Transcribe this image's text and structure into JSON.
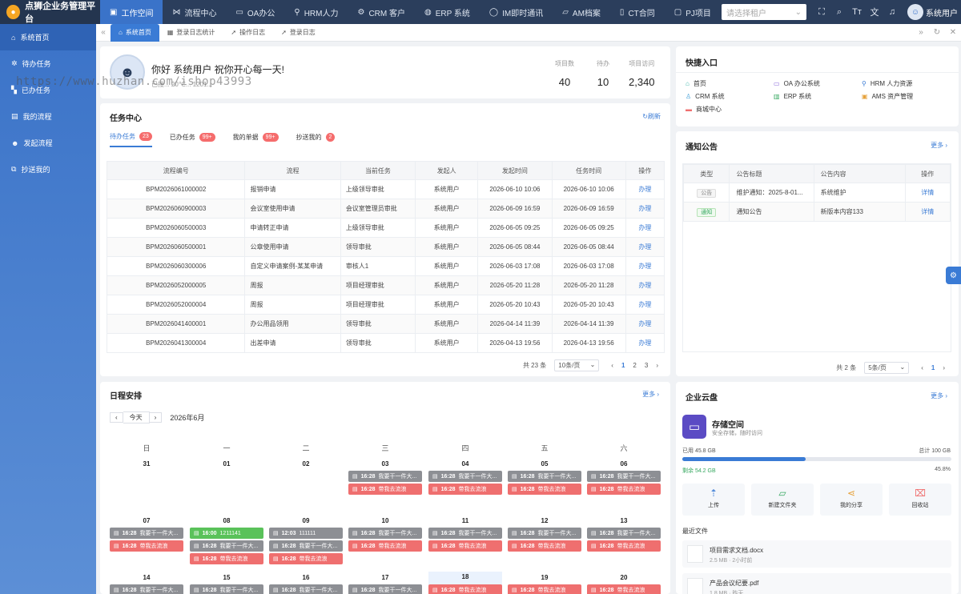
{
  "topbar": {
    "title": "点狮企业务管理平台",
    "nav": [
      {
        "label": "工作空间",
        "icon": "briefcase-icon",
        "active": true
      },
      {
        "label": "流程中心",
        "icon": "flow-icon"
      },
      {
        "label": "OA办公",
        "icon": "monitor-icon"
      },
      {
        "label": "HRM人力",
        "icon": "person-icon"
      },
      {
        "label": "CRM 客户",
        "icon": "gear-icon"
      },
      {
        "label": "ERP 系统",
        "icon": "globe-icon"
      },
      {
        "label": "IM即时通讯",
        "icon": "chat-icon"
      },
      {
        "label": "AM档案",
        "icon": "folder-icon"
      },
      {
        "label": "CT合同",
        "icon": "bookmark-icon"
      },
      {
        "label": "PJ项目",
        "icon": "project-icon"
      }
    ],
    "more": "···",
    "tenant_placeholder": "请选择租户",
    "user_name": "系统用户"
  },
  "sidebar": {
    "items": [
      {
        "label": "系统首页",
        "active": true
      },
      {
        "label": "待办任务"
      },
      {
        "label": "已办任务"
      },
      {
        "label": "我的流程"
      },
      {
        "label": "发起流程"
      },
      {
        "label": "抄送我的"
      }
    ]
  },
  "tabs": [
    {
      "label": "系统首页",
      "active": true
    },
    {
      "label": "登录日志统计"
    },
    {
      "label": "操作日志"
    },
    {
      "label": "登录日志"
    }
  ],
  "welcome": {
    "greeting": "你好 系统用户 祝你开心每一天!",
    "sub": "已接...  20℃...  1201...",
    "stats": [
      {
        "label": "项目数",
        "value": "40"
      },
      {
        "label": "待办",
        "value": "10"
      },
      {
        "label": "项目访问",
        "value": "2,340"
      }
    ]
  },
  "tasks": {
    "title": "任务中心",
    "refresh": "刷新",
    "tabs": [
      {
        "label": "待办任务",
        "badge": "23",
        "active": true
      },
      {
        "label": "已办任务",
        "badge": "99+"
      },
      {
        "label": "我的单据",
        "badge": "99+"
      },
      {
        "label": "抄送我的",
        "badge": "2"
      }
    ],
    "columns": [
      "流程编号",
      "流程",
      "当前任务",
      "发起人",
      "发起时间",
      "任务时间",
      "操作"
    ],
    "rows": [
      [
        "BPM2026061000002",
        "报销申请",
        "上级领导审批",
        "系统用户",
        "2026-06-10 10:06",
        "2026-06-10 10:06",
        "办理"
      ],
      [
        "BPM2026060900003",
        "会议室使用申请",
        "会议室管理员审批",
        "系统用户",
        "2026-06-09 16:59",
        "2026-06-09 16:59",
        "办理"
      ],
      [
        "BPM2026060500003",
        "申请转正申请",
        "上级领导审批",
        "系统用户",
        "2026-06-05 09:25",
        "2026-06-05 09:25",
        "办理"
      ],
      [
        "BPM2026060500001",
        "公章使用申请",
        "领导审批",
        "系统用户",
        "2026-06-05 08:44",
        "2026-06-05 08:44",
        "办理"
      ],
      [
        "BPM2026060300006",
        "自定义申请案例-某某申请",
        "审核人1",
        "系统用户",
        "2026-06-03 17:08",
        "2026-06-03 17:08",
        "办理"
      ],
      [
        "BPM2026052000005",
        "周报",
        "项目经理审批",
        "系统用户",
        "2026-05-20 11:28",
        "2026-05-20 11:28",
        "办理"
      ],
      [
        "BPM2026052000004",
        "周报",
        "项目经理审批",
        "系统用户",
        "2026-05-20 10:43",
        "2026-05-20 10:43",
        "办理"
      ],
      [
        "BPM2026041400001",
        "办公用品领用",
        "领导审批",
        "系统用户",
        "2026-04-14 11:39",
        "2026-04-14 11:39",
        "办理"
      ],
      [
        "BPM2026041300004",
        "出差申请",
        "领导审批",
        "系统用户",
        "2026-04-13 19:56",
        "2026-04-13 19:56",
        "办理"
      ]
    ],
    "pager": {
      "total": "共 23 条",
      "size": "10条/页",
      "pages": [
        "1",
        "2",
        "3"
      ],
      "current": "1"
    }
  },
  "calendar": {
    "title": "日程安排",
    "more": "更多",
    "today": "今天",
    "month": "2026年6月",
    "weekdays": [
      "日",
      "一",
      "二",
      "三",
      "四",
      "五",
      "六"
    ],
    "weeks": [
      [
        "31",
        "01",
        "02",
        "03",
        "04",
        "05",
        "06"
      ],
      [
        "07",
        "08",
        "09",
        "10",
        "11",
        "12",
        "13"
      ],
      [
        "14",
        "15",
        "16",
        "17",
        "18",
        "19",
        "20"
      ]
    ],
    "event_gray": "我要干一件大...",
    "event_red": "带我去流浪",
    "event_time": "16:28",
    "event_green_time": "16:00",
    "event_green": "1211141",
    "event_0912_time": "12:03",
    "event_0912": "111111"
  },
  "quick": {
    "title": "快捷入口",
    "items": [
      {
        "label": "首页",
        "icon": "home-icon",
        "color": "#36b3a8"
      },
      {
        "label": "OA 办公系统",
        "icon": "monitor-icon",
        "color": "#8e6cdc"
      },
      {
        "label": "HRM 人力资源",
        "icon": "person-icon",
        "color": "#3a7bd5"
      },
      {
        "label": "CRM 系统",
        "icon": "user-icon",
        "color": "#3a9bd5"
      },
      {
        "label": "ERP 系统",
        "icon": "chart-icon",
        "color": "#36a860"
      },
      {
        "label": "AMS 资产管理",
        "icon": "box-icon",
        "color": "#e6a23c"
      },
      {
        "label": "商城中心",
        "icon": "shop-icon",
        "color": "#ef6f6f"
      }
    ]
  },
  "notice": {
    "title": "通知公告",
    "more": "更多",
    "columns": [
      "类型",
      "公告标题",
      "公告内容",
      "操作"
    ],
    "rows": [
      {
        "type": "公告",
        "title": "维护通知：2025-8-01...",
        "content": "系统维护",
        "action": "详情"
      },
      {
        "type": "通知",
        "title": "通知公告",
        "content": "新版本内容133",
        "action": "详情"
      }
    ],
    "pager": {
      "total": "共 2 条",
      "size": "5条/页",
      "current": "1"
    }
  },
  "cloud": {
    "title": "企业云盘",
    "more": "更多",
    "space_title": "存储空间",
    "space_sub": "安全存储，随时访问",
    "used": "已用 45.8 GB",
    "total": "总计 100 GB",
    "left": "剩余 54.2 GB",
    "percent": "45.8%",
    "percent_value": 45.8,
    "buttons": [
      {
        "label": "上传",
        "icon": "upload-icon"
      },
      {
        "label": "新建文件夹",
        "icon": "folder-icon"
      },
      {
        "label": "我的分享",
        "icon": "share-icon"
      },
      {
        "label": "回收站",
        "icon": "trash-icon"
      }
    ],
    "recent_title": "最近文件",
    "files": [
      {
        "name": "项目需求文档.docx",
        "meta": "2.5 MB · 2小时前"
      },
      {
        "name": "产品会议纪要.pdf",
        "meta": "1.8 MB · 昨天"
      }
    ]
  },
  "watermark": "https://www.huzhan.com/ishop43993"
}
